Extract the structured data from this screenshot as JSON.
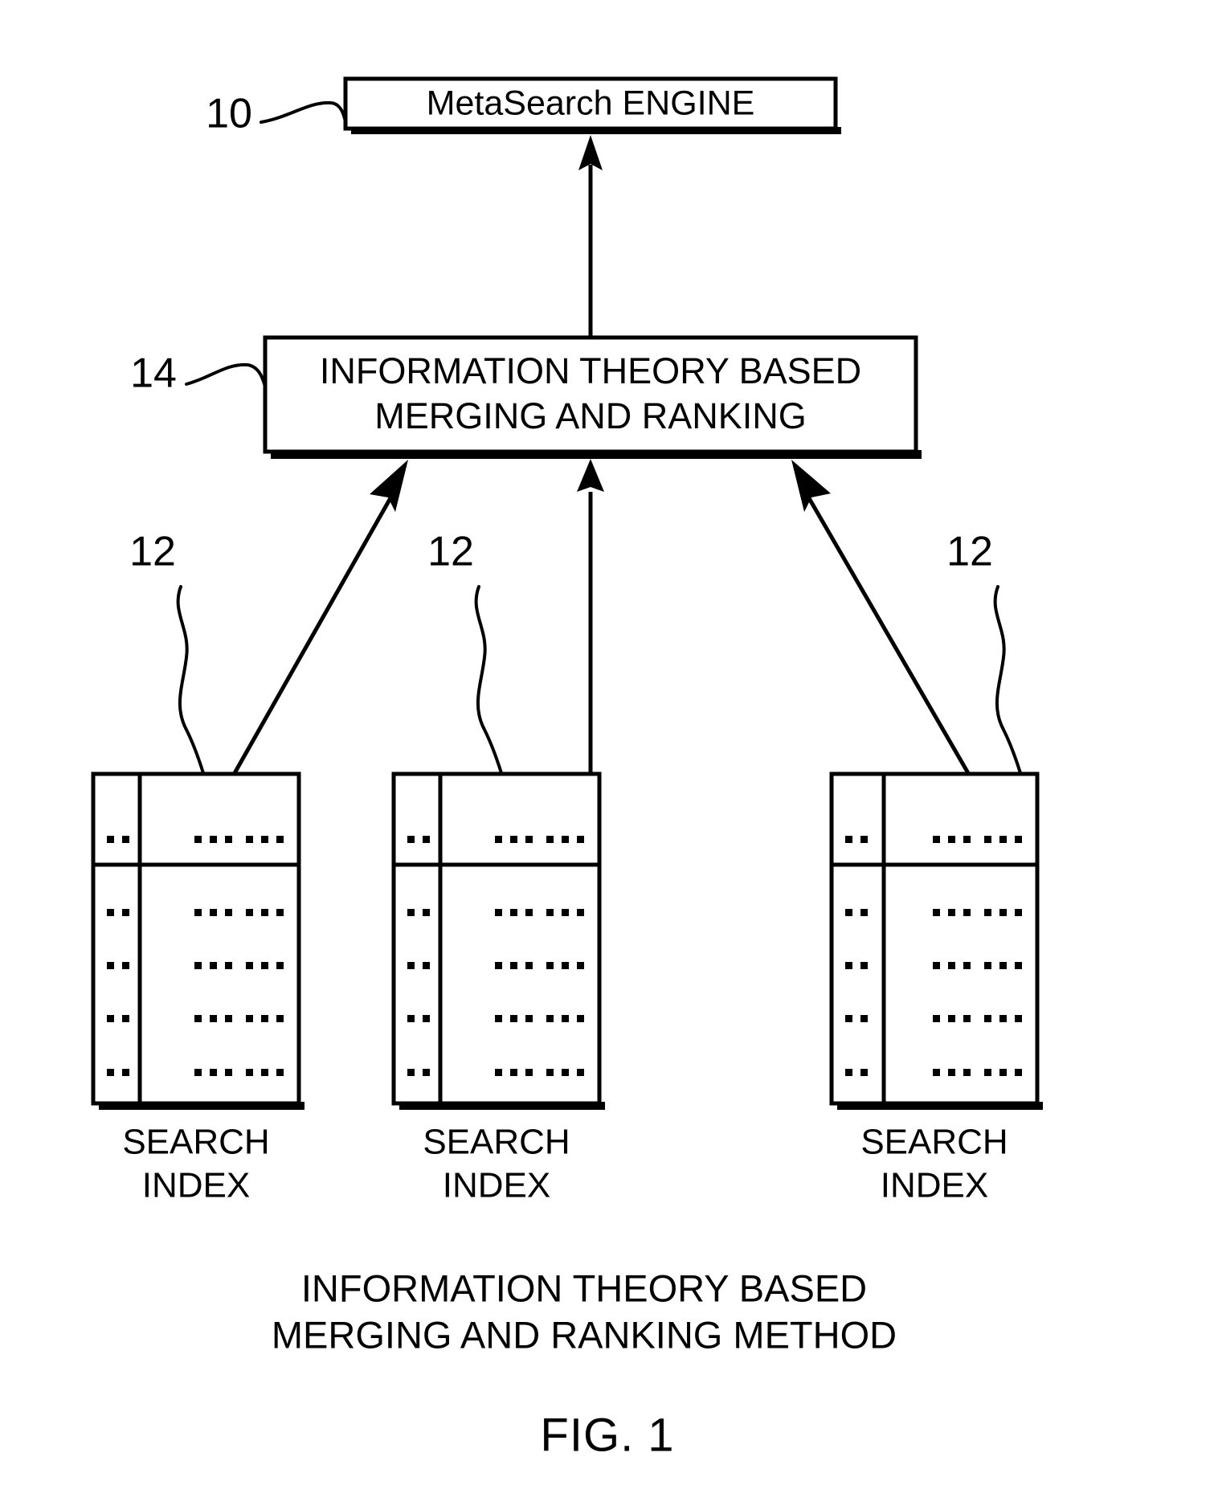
{
  "figure": {
    "label": "FIG. 1",
    "caption_line1": "INFORMATION THEORY BASED",
    "caption_line2": "MERGING AND RANKING METHOD"
  },
  "engine_box": {
    "ref": "10",
    "label": "MetaSearch ENGINE"
  },
  "merge_box": {
    "ref": "14",
    "label_line1": "INFORMATION THEORY BASED",
    "label_line2": "MERGING AND RANKING"
  },
  "search_indexes": [
    {
      "ref": "12",
      "label_line1": "SEARCH",
      "label_line2": "INDEX",
      "rows": [
        {
          "col1": "..",
          "col2": "... ..."
        },
        {
          "col1": "..",
          "col2": "... ..."
        },
        {
          "col1": "..",
          "col2": "... ..."
        },
        {
          "col1": "..",
          "col2": "... ..."
        },
        {
          "col1": "..",
          "col2": "... ..."
        }
      ]
    },
    {
      "ref": "12",
      "label_line1": "SEARCH",
      "label_line2": "INDEX",
      "rows": [
        {
          "col1": "..",
          "col2": "... ..."
        },
        {
          "col1": "..",
          "col2": "... ..."
        },
        {
          "col1": "..",
          "col2": "... ..."
        },
        {
          "col1": "..",
          "col2": "... ..."
        },
        {
          "col1": "..",
          "col2": "... ..."
        }
      ]
    },
    {
      "ref": "12",
      "label_line1": "SEARCH",
      "label_line2": "INDEX",
      "rows": [
        {
          "col1": "..",
          "col2": "... ..."
        },
        {
          "col1": "..",
          "col2": "... ..."
        },
        {
          "col1": "..",
          "col2": "... ..."
        },
        {
          "col1": "..",
          "col2": "... ..."
        },
        {
          "col1": "..",
          "col2": "... ..."
        }
      ]
    }
  ],
  "colors": {
    "ink": "#000000",
    "paper": "#ffffff"
  }
}
